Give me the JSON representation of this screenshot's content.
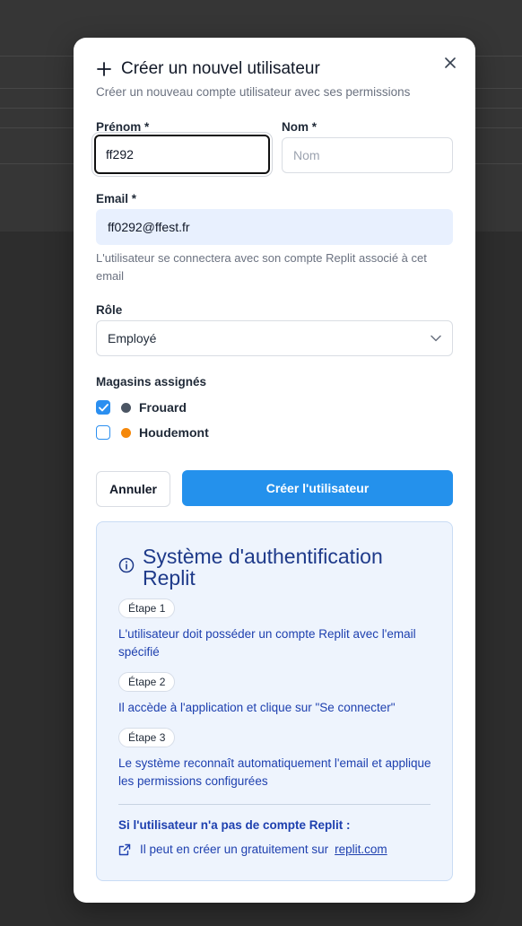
{
  "dialog": {
    "title": "Créer un nouvel utilisateur",
    "subtitle": "Créer un nouveau compte utilisateur avec ses permissions"
  },
  "form": {
    "first_name_label": "Prénom *",
    "first_name_value": "ff292",
    "last_name_label": "Nom *",
    "last_name_placeholder": "Nom",
    "email_label": "Email *",
    "email_value": "ff0292@ffest.fr",
    "email_hint": "L'utilisateur se connectera avec son compte Replit associé à cet email",
    "role_label": "Rôle",
    "role_value": "Employé",
    "stores_label": "Magasins assignés",
    "stores": [
      {
        "name": "Frouard",
        "checked": true,
        "color": "#4b5563"
      },
      {
        "name": "Houdemont",
        "checked": false,
        "color": "#f59e0b"
      }
    ]
  },
  "actions": {
    "cancel_label": "Annuler",
    "create_label": "Créer l'utilisateur"
  },
  "info": {
    "title": "Système d'authentification Replit",
    "steps": [
      {
        "badge": "Étape 1",
        "text": "L'utilisateur doit posséder un compte Replit avec l'email spécifié"
      },
      {
        "badge": "Étape 2",
        "text": "Il accède à l'application et clique sur \"Se connecter\""
      },
      {
        "badge": "Étape 3",
        "text": "Le système reconnaît automatiquement l'email et applique les permissions configurées"
      }
    ],
    "note": "Si l'utilisateur n'a pas de compte Replit :",
    "link_prefix": "Il peut en créer un gratuitement sur",
    "link_text": "replit.com"
  },
  "colors": {
    "accent": "#2491ec",
    "info_text": "#1e40af"
  }
}
